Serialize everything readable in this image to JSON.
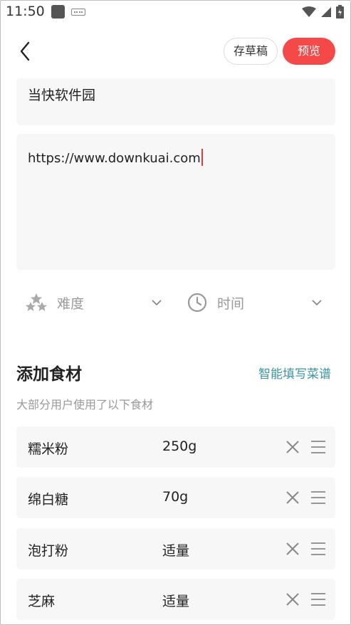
{
  "status": {
    "time": "11:50"
  },
  "header": {
    "draft_label": "存草稿",
    "preview_label": "预览"
  },
  "form": {
    "title_value": "当快软件园",
    "description_value": "https://www.downkuai.com",
    "difficulty_label": "难度",
    "time_label": "时间"
  },
  "ingredients": {
    "title": "添加食材",
    "smart_fill_label": "智能填写菜谱",
    "hint": "大部分用户使用了以下食材",
    "items": [
      {
        "name": "糯米粉",
        "amount": "250g"
      },
      {
        "name": "绵白糖",
        "amount": "70g"
      },
      {
        "name": "泡打粉",
        "amount": "适量"
      },
      {
        "name": "芝麻",
        "amount": "适量"
      }
    ]
  },
  "colors": {
    "accent": "#f54848",
    "link": "#3a94a3",
    "card": "#f7f7f7"
  },
  "icons": [
    "back-icon",
    "stars-icon",
    "clock-icon",
    "chevron-down-icon",
    "close-icon",
    "drag-handle-icon",
    "wifi-icon",
    "signal-icon",
    "battery-icon",
    "keyboard-icon"
  ]
}
